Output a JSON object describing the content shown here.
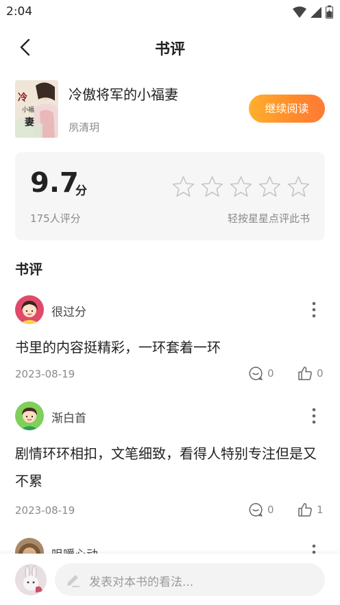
{
  "status_bar": {
    "time": "2:04"
  },
  "header": {
    "title": "书评"
  },
  "book": {
    "title": "冷傲将军的小福妻",
    "author": "夙清玥",
    "cover_text": "冷傲将军的小福妻",
    "continue_label": "继续阅读"
  },
  "rating": {
    "score": "9.7",
    "unit": "分",
    "count_text": "175人评分",
    "hint": "轻按星星点评此书",
    "stars_total": 5,
    "stars_filled": 0
  },
  "section_title": "书评",
  "reviews": [
    {
      "name": "很过分",
      "content": "书里的内容挺精彩，一环套着一环",
      "date": "2023-08-19",
      "comments": "0",
      "likes": "0"
    },
    {
      "name": "渐白首",
      "content": "剧情环环相扣，文笔细致，看得人特别专注但是又不累",
      "date": "2023-08-19",
      "comments": "0",
      "likes": "1"
    },
    {
      "name": "咀嚼心动"
    }
  ],
  "bottom_bar": {
    "placeholder": "发表对本书的看法..."
  },
  "colors": {
    "accent_start": "#ffb02e",
    "accent_end": "#ff7a36",
    "card_bg": "#f6f6f6",
    "muted_text": "#8a8a8a"
  }
}
